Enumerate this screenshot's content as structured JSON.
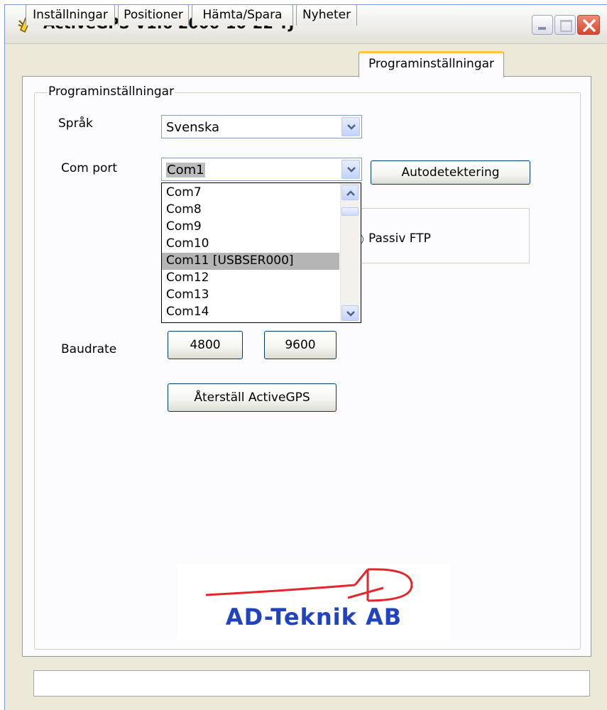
{
  "window": {
    "title": "ActiveGPS V1.6 2006-10-22 TJ"
  },
  "tabs": [
    {
      "label": "Inställningar",
      "active": false
    },
    {
      "label": "Positioner",
      "active": false
    },
    {
      "label": "Hämta/Spara",
      "active": false
    },
    {
      "label": "Nyheter",
      "active": false
    },
    {
      "label": "Programinställningar",
      "active": true
    }
  ],
  "group": {
    "legend": "Programinställningar"
  },
  "language": {
    "label": "Språk",
    "value": "Svenska"
  },
  "com_port": {
    "label": "Com port",
    "value": "Com1",
    "autodetect_label": "Autodetektering",
    "options": [
      "Com7",
      "Com8",
      "Com9",
      "Com10",
      "Com11 [USBSER000]",
      "Com12",
      "Com13",
      "Com14"
    ],
    "highlighted": "Com11 [USBSER000]"
  },
  "ftp": {
    "passive_label": "Passiv FTP"
  },
  "baudrate": {
    "label": "Baudrate",
    "option_1": "4800",
    "option_2": "9600"
  },
  "reset_button": "Återställ ActiveGPS",
  "logo": {
    "text": "AD-Teknik AB",
    "accent_color": "#e3262b",
    "text_color": "#2243c0"
  },
  "status": {
    "text": ""
  }
}
